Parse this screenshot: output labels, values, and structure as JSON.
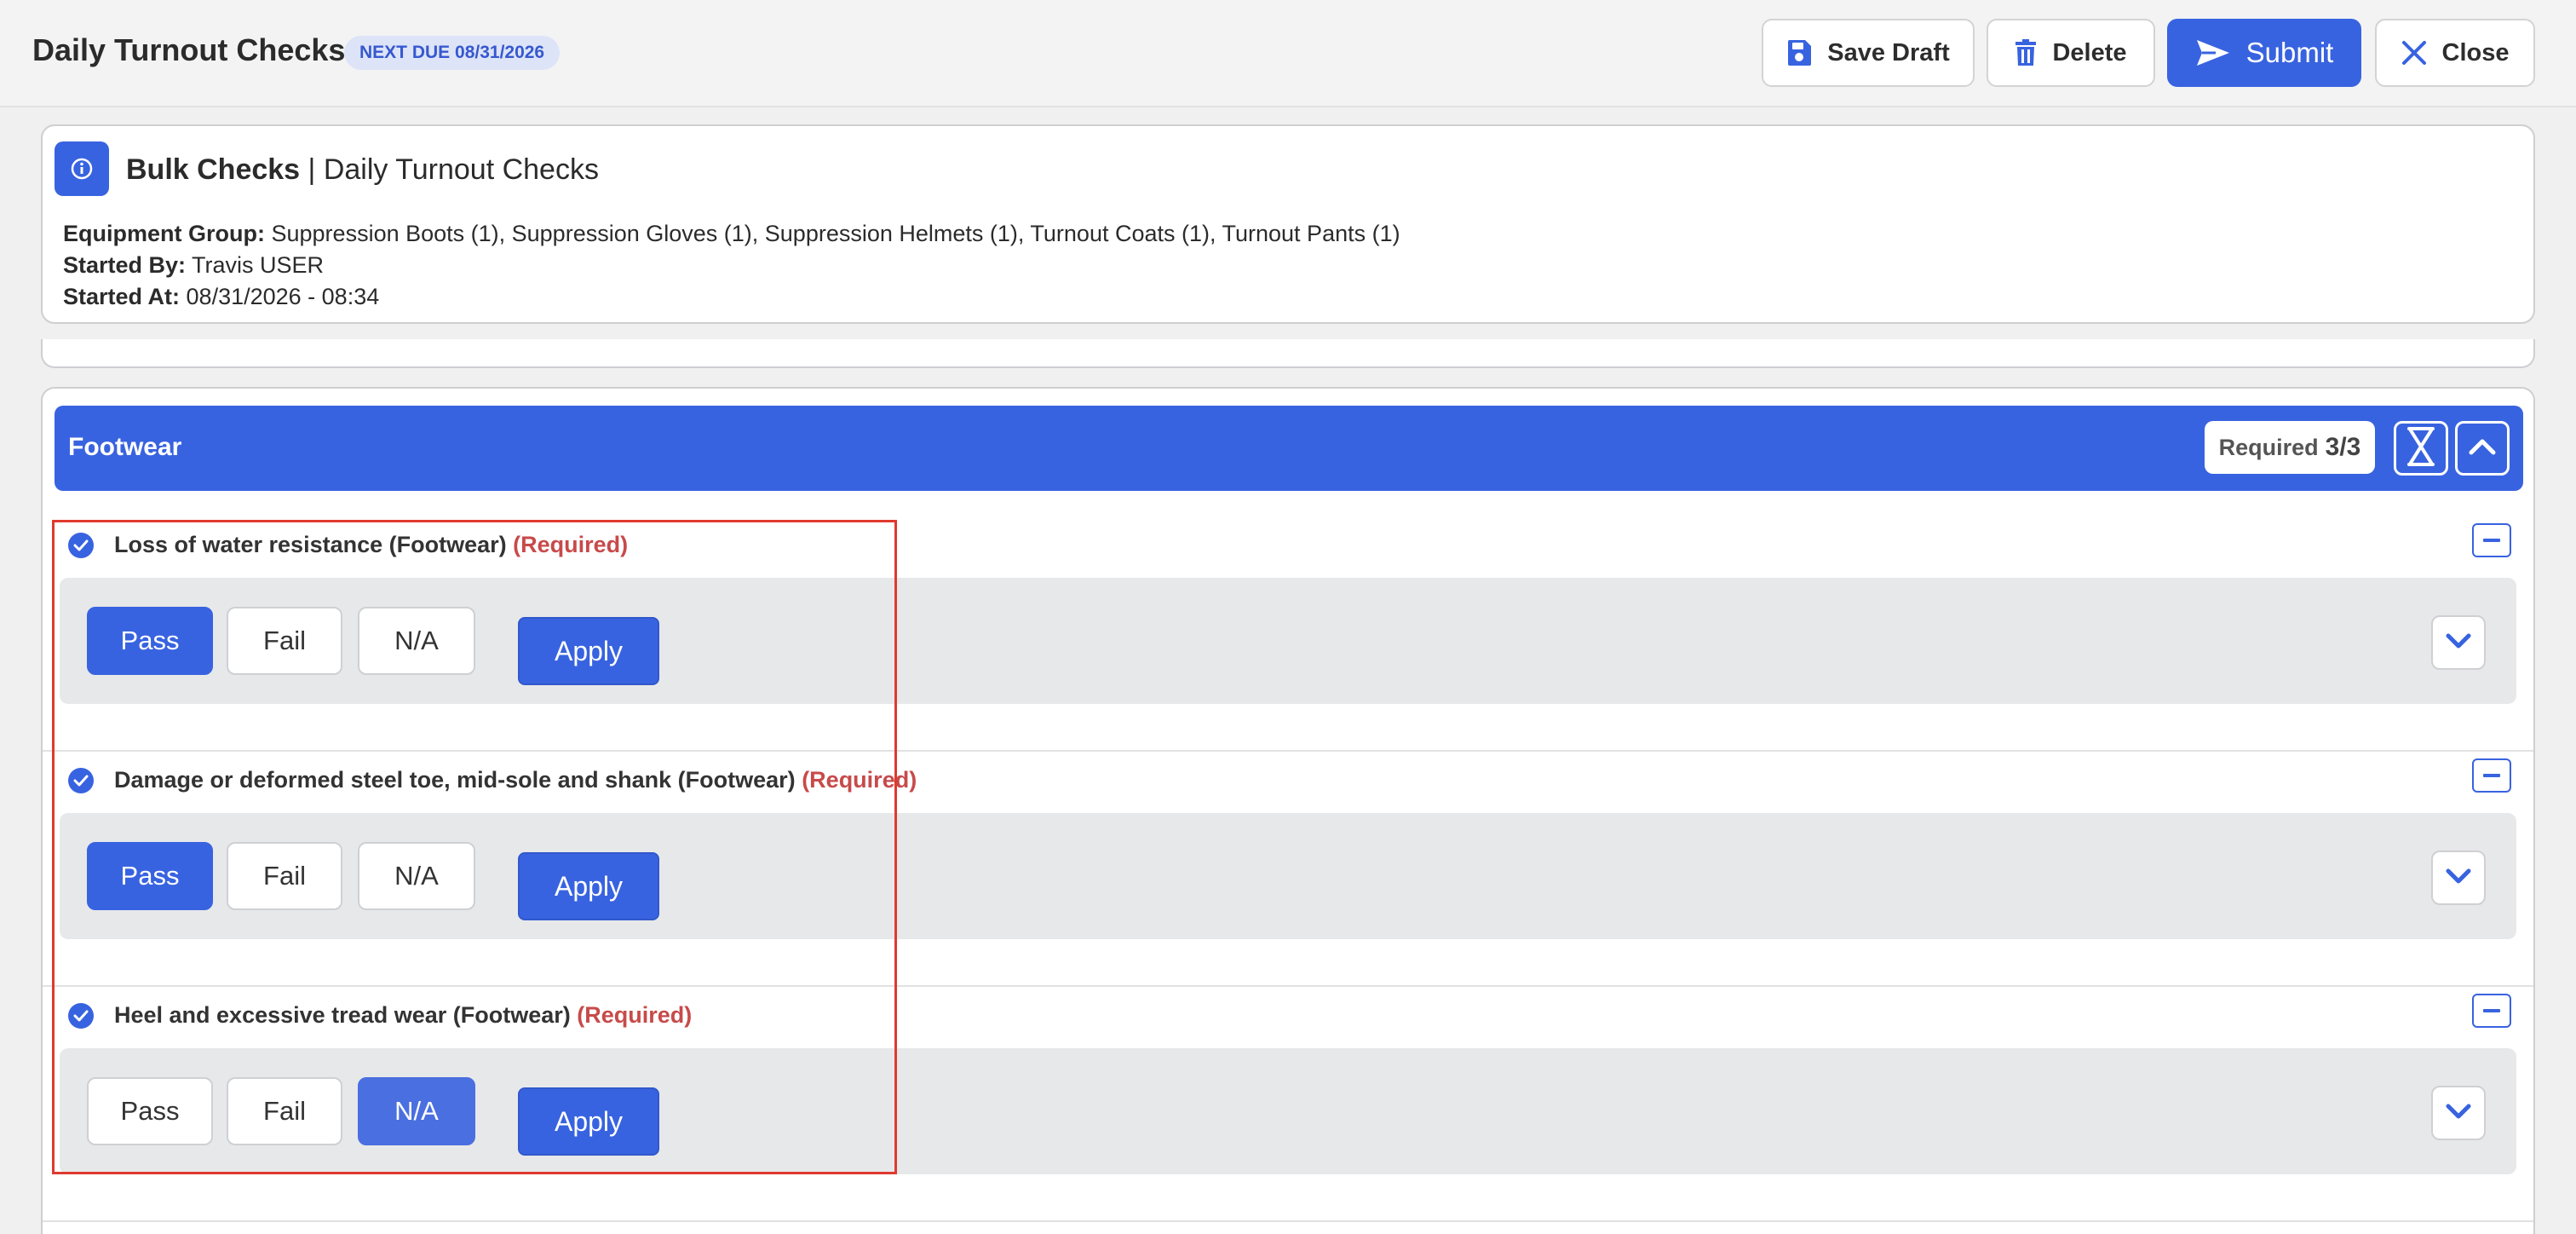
{
  "header": {
    "title": "Daily Turnout Checks",
    "due_badge": "NEXT DUE 08/31/2026",
    "save_draft": "Save Draft",
    "delete": "Delete",
    "submit": "Submit",
    "close": "Close"
  },
  "info": {
    "title_bold": "Bulk Checks",
    "title_rest": "| Daily Turnout Checks",
    "equipment_label": "Equipment Group:",
    "equipment_value": "Suppression Boots (1), Suppression Gloves (1), Suppression Helmets (1), Turnout Coats (1), Turnout Pants (1)",
    "started_by_label": "Started By:",
    "started_by_value": "Travis USER",
    "started_at_label": "Started At:",
    "started_at_value": "08/31/2026 - 08:34"
  },
  "section": {
    "title": "Footwear",
    "required_label": "Required",
    "required_count": "3/3",
    "items": [
      {
        "label": "Loss of water resistance (Footwear)",
        "required": "(Required)",
        "options": [
          "Pass",
          "Fail",
          "N/A"
        ],
        "selected": "Pass",
        "apply": "Apply"
      },
      {
        "label": "Damage or deformed steel toe, mid-sole and shank (Footwear)",
        "required": "(Required)",
        "options": [
          "Pass",
          "Fail",
          "N/A"
        ],
        "selected": "Pass",
        "apply": "Apply"
      },
      {
        "label": "Heel and excessive tread wear (Footwear)",
        "required": "(Required)",
        "options": [
          "Pass",
          "Fail",
          "N/A"
        ],
        "selected": "N/A",
        "apply": "Apply"
      }
    ]
  },
  "colors": {
    "accent": "#3863e0",
    "required_text": "#c84a4a",
    "highlight_box": "#e0392e"
  }
}
